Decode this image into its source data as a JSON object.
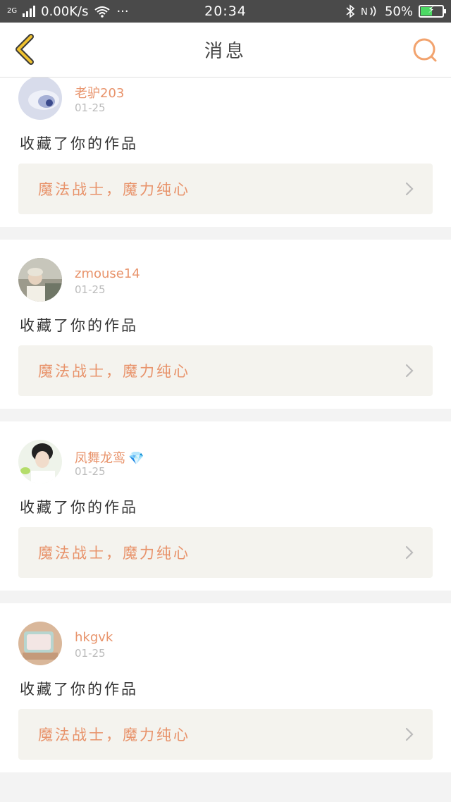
{
  "status_bar": {
    "network_type": "2G",
    "speed": "0.00K/s",
    "dots": "···",
    "time": "20:34",
    "battery_percent": "50%",
    "battery_level": 0.5
  },
  "header": {
    "title": "消息"
  },
  "colors": {
    "accent": "#e8936b",
    "back_icon": "#f0c230",
    "card_bg": "#f4f3ee",
    "status_bar": "#4a4a4a"
  },
  "messages": [
    {
      "username": "老驴203",
      "date": "01-25",
      "action": "收藏了你的作品",
      "work": "魔法战士，魔力纯心",
      "badge": ""
    },
    {
      "username": "zmouse14",
      "date": "01-25",
      "action": "收藏了你的作品",
      "work": "魔法战士，魔力纯心",
      "badge": ""
    },
    {
      "username": "凤舞龙鸾",
      "date": "01-25",
      "action": "收藏了你的作品",
      "work": "魔法战士，魔力纯心",
      "badge": "💎"
    },
    {
      "username": "hkgvk",
      "date": "01-25",
      "action": "收藏了你的作品",
      "work": "魔法战士，魔力纯心",
      "badge": ""
    }
  ]
}
